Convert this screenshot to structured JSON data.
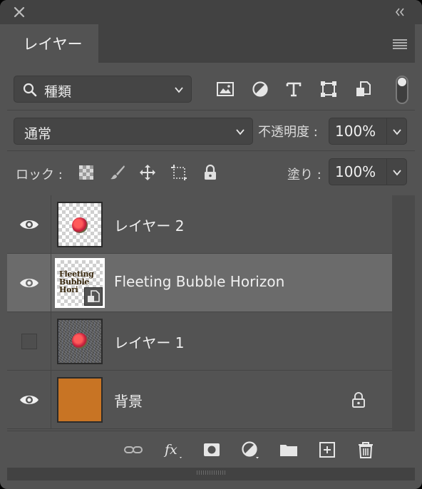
{
  "window": {
    "close_icon": "close-icon",
    "collapse_icon": "double-chevron-left-icon"
  },
  "panel": {
    "tab_title": "レイヤー",
    "menu_icon": "hamburger-menu-icon"
  },
  "filter": {
    "kind_label": "種類",
    "icons": [
      "image-filter-icon",
      "adjustment-filter-icon",
      "type-filter-icon",
      "shape-filter-icon",
      "smart-object-filter-icon"
    ]
  },
  "blend": {
    "mode": "通常",
    "opacity_label": "不透明度 :",
    "opacity_value": "100%"
  },
  "lock": {
    "label": "ロック :",
    "icons": [
      "lock-transparent-pixels-icon",
      "lock-image-pixels-icon",
      "lock-position-icon",
      "lock-artboard-icon",
      "lock-all-icon"
    ],
    "fill_label": "塗り :",
    "fill_value": "100%"
  },
  "layers": [
    {
      "name": "レイヤー 2",
      "visible": true,
      "selected": false,
      "thumb": "transparent-with-ball"
    },
    {
      "name": "Fleeting Bubble Horizon",
      "visible": true,
      "selected": true,
      "thumb": "text-smart-object",
      "thumb_text": "Fleeting Bubble Hori"
    },
    {
      "name": "レイヤー 1",
      "visible": false,
      "selected": false,
      "thumb": "noise-with-ball"
    },
    {
      "name": "背景",
      "visible": true,
      "selected": false,
      "thumb": "solid",
      "thumb_color": "#c87424",
      "locked": true
    }
  ],
  "footer": {
    "icons": [
      "link-layers-icon",
      "layer-style-fx-icon",
      "add-mask-icon",
      "adjustment-layer-icon",
      "new-group-folder-icon",
      "new-layer-icon",
      "delete-trash-icon"
    ]
  },
  "colors": {
    "panel_bg": "#535353",
    "selected_row": "#6b6b6b",
    "background_fill": "#c87424"
  }
}
